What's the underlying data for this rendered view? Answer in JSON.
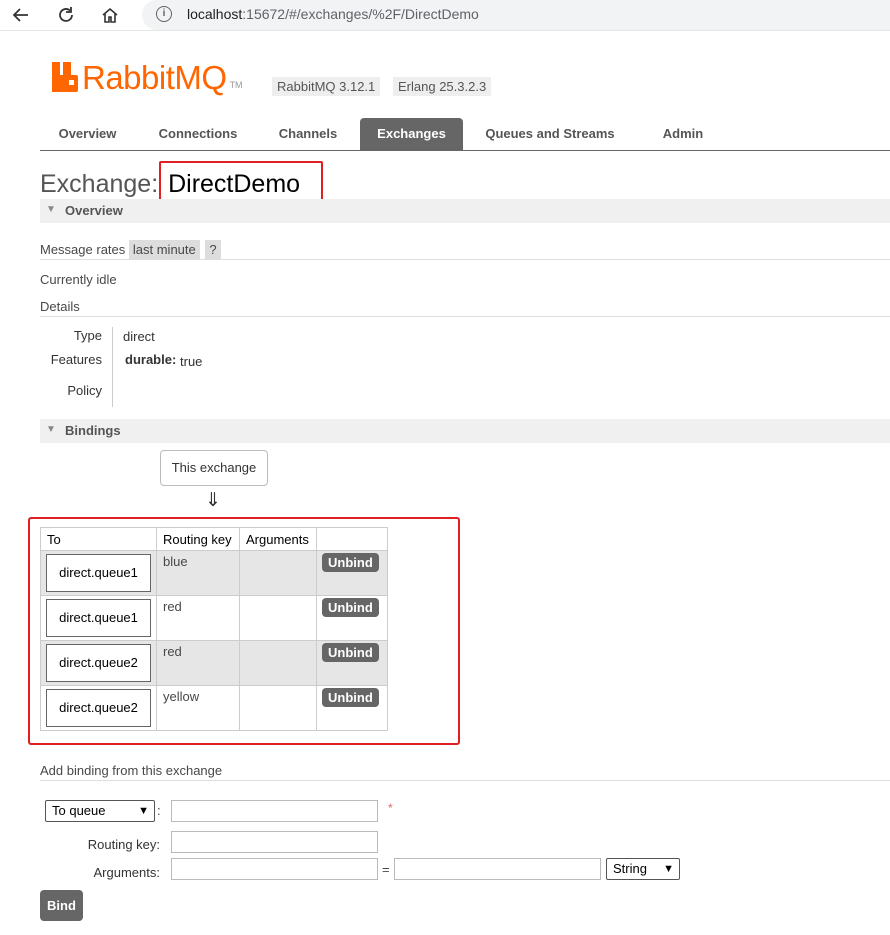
{
  "browser": {
    "url_host": "localhost",
    "url_path": ":15672/#/exchanges/%2F/DirectDemo"
  },
  "header": {
    "logo_text_rabbit": "Rabbit",
    "logo_text_mq": "MQ",
    "logo_tm": "TM",
    "version_rabbitmq": "RabbitMQ 3.12.1",
    "version_erlang": "Erlang 25.3.2.3"
  },
  "tabs": [
    {
      "label": "Overview"
    },
    {
      "label": "Connections"
    },
    {
      "label": "Channels"
    },
    {
      "label": "Exchanges",
      "active": true
    },
    {
      "label": "Queues and Streams"
    },
    {
      "label": "Admin"
    }
  ],
  "page": {
    "title_prefix": "Exchange: ",
    "title_name": "DirectDemo"
  },
  "overview": {
    "heading": "Overview",
    "message_rates_label": "Message rates",
    "message_rates_period": "last minute",
    "help_mark": "?",
    "status": "Currently idle",
    "details_label": "Details",
    "type_label": "Type",
    "type_value": "direct",
    "features_label": "Features",
    "durable_label": "durable:",
    "durable_value": "true",
    "policy_label": "Policy"
  },
  "bindings": {
    "heading": "Bindings",
    "source_label": "This exchange",
    "arrow": "⇓",
    "columns": [
      "To",
      "Routing key",
      "Arguments",
      ""
    ],
    "rows": [
      {
        "to": "direct.queue1",
        "routing_key": "blue",
        "arguments": "",
        "action": "Unbind"
      },
      {
        "to": "direct.queue1",
        "routing_key": "red",
        "arguments": "",
        "action": "Unbind"
      },
      {
        "to": "direct.queue2",
        "routing_key": "red",
        "arguments": "",
        "action": "Unbind"
      },
      {
        "to": "direct.queue2",
        "routing_key": "yellow",
        "arguments": "",
        "action": "Unbind"
      }
    ]
  },
  "add_binding": {
    "heading": "Add binding from this exchange",
    "destination_type": "To queue",
    "colon": ":",
    "required_mark": "*",
    "routing_key_label": "Routing key:",
    "arguments_label": "Arguments:",
    "equals": "=",
    "arg_type": "String",
    "bind_button": "Bind"
  },
  "colors": {
    "accent": "#ff6600",
    "tab_active": "#666666",
    "highlight_box": "#e02020"
  }
}
